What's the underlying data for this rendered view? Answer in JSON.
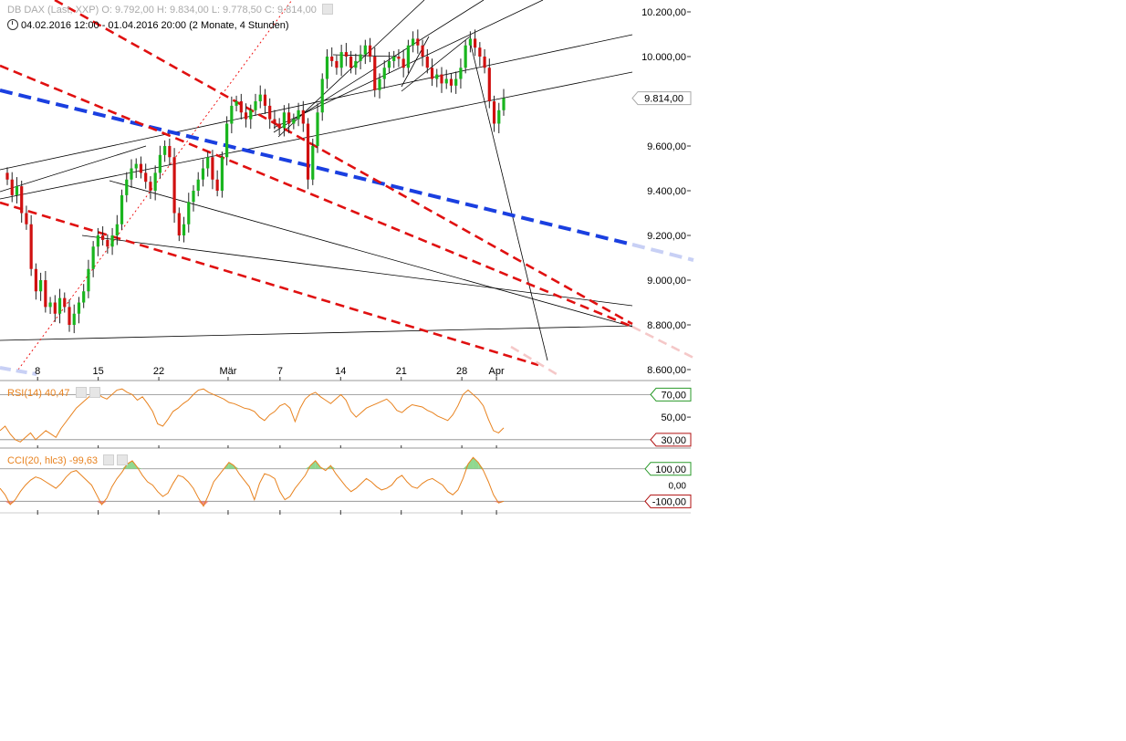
{
  "header": {
    "instrument": "DB DAX (Last, XXP)",
    "open": "O: 9.792,00",
    "high": "H: 9.834,00",
    "low": "L: 9.778,50",
    "close": "C: 9.814,00",
    "range": "04.02.2016 12:00 - 01.04.2016 20:00 (2 Monate, 4 Stunden)"
  },
  "chart_data": [
    {
      "type": "candlestick",
      "title": "DB DAX",
      "interval_hours": 4,
      "y_ticks": [
        "10.200,00",
        "10.000,00",
        "9.600,00",
        "9.400,00",
        "9.200,00",
        "9.000,00",
        "8.800,00",
        "8.600,00"
      ],
      "y_tick_values": [
        10200,
        10000,
        9600,
        9400,
        9200,
        9000,
        8800,
        8600
      ],
      "ylim": [
        8550,
        10400
      ],
      "x_ticks": [
        "8",
        "15",
        "22",
        "Mär",
        "7",
        "14",
        "21",
        "28",
        "Apr"
      ],
      "x_tick_dates": [
        "2016-02-08",
        "2016-02-15",
        "2016-02-22",
        "2016-03-01",
        "2016-03-07",
        "2016-03-14",
        "2016-03-21",
        "2016-03-28",
        "2016-04-01"
      ],
      "last_price_label": "9.814,00",
      "last_price": 9814,
      "closes": [
        9450,
        9380,
        9420,
        9300,
        9250,
        9050,
        8950,
        9000,
        8880,
        8900,
        8850,
        8920,
        8880,
        8800,
        8850,
        8900,
        8950,
        9050,
        9150,
        9200,
        9180,
        9150,
        9200,
        9250,
        9380,
        9450,
        9500,
        9520,
        9480,
        9440,
        9400,
        9480,
        9560,
        9600,
        9550,
        9300,
        9200,
        9250,
        9350,
        9400,
        9450,
        9500,
        9550,
        9450,
        9400,
        9550,
        9700,
        9780,
        9800,
        9750,
        9720,
        9760,
        9800,
        9830,
        9780,
        9720,
        9700,
        9680,
        9750,
        9700,
        9720,
        9760,
        9700,
        9450,
        9600,
        9750,
        9900,
        10000,
        9980,
        9950,
        10020,
        10000,
        9950,
        9980,
        10010,
        10050,
        10000,
        9850,
        9900,
        9950,
        9980,
        10000,
        9990,
        9950,
        10050,
        10080,
        10050,
        10000,
        9950,
        9900,
        9920,
        9880,
        9900,
        9870,
        9900,
        9950,
        10050,
        10080,
        10040,
        10000,
        9950,
        9800,
        9700,
        9760,
        9814
      ],
      "lines": {
        "trend_support_black": [
          [
            9640,
            9700
          ],
          [
            9900,
            9955
          ]
        ],
        "blue_dashed": [
          [
            9810,
            9210
          ]
        ],
        "red_dashed": [
          [
            10260,
            8780
          ],
          [
            10150,
            8560
          ],
          [
            9600,
            8450
          ]
        ]
      }
    },
    {
      "type": "line",
      "title": "RSI(14)",
      "value_label": "40,47",
      "levels": [
        "70,00",
        "50,00",
        "30,00"
      ],
      "level_values": [
        70,
        50,
        30
      ],
      "ylim": [
        25,
        80
      ],
      "values": [
        38,
        42,
        35,
        30,
        28,
        32,
        36,
        30,
        34,
        38,
        35,
        32,
        40,
        46,
        52,
        58,
        62,
        66,
        70,
        72,
        68,
        66,
        70,
        74,
        75,
        72,
        70,
        65,
        68,
        62,
        55,
        44,
        42,
        48,
        55,
        58,
        62,
        65,
        70,
        74,
        75,
        72,
        70,
        68,
        66,
        63,
        62,
        60,
        58,
        57,
        55,
        50,
        47,
        52,
        55,
        60,
        62,
        58,
        46,
        58,
        66,
        70,
        72,
        68,
        65,
        62,
        66,
        70,
        65,
        55,
        50,
        54,
        58,
        60,
        62,
        64,
        66,
        62,
        56,
        54,
        58,
        61,
        60,
        59,
        56,
        54,
        51,
        49,
        47,
        52,
        60,
        70,
        74,
        70,
        66,
        60,
        48,
        38,
        36,
        40.47
      ]
    },
    {
      "type": "area",
      "title": "CCI(20, hlc3)",
      "value_label": "-99,63",
      "levels": [
        "100,00",
        "0,00",
        "-100,00"
      ],
      "level_values": [
        100,
        0,
        -100
      ],
      "ylim": [
        -160,
        200
      ],
      "values": [
        -20,
        -60,
        -120,
        -90,
        -40,
        0,
        30,
        50,
        40,
        20,
        0,
        -20,
        10,
        50,
        80,
        90,
        60,
        30,
        0,
        -60,
        -120,
        -80,
        -10,
        40,
        80,
        130,
        150,
        110,
        60,
        20,
        0,
        -40,
        -70,
        -50,
        10,
        60,
        50,
        20,
        -20,
        -80,
        -130,
        -60,
        20,
        60,
        100,
        140,
        120,
        70,
        30,
        -10,
        -90,
        10,
        70,
        60,
        40,
        -40,
        -90,
        -70,
        -20,
        20,
        60,
        120,
        150,
        110,
        90,
        120,
        70,
        30,
        -10,
        -40,
        -20,
        10,
        40,
        20,
        -10,
        -30,
        -20,
        0,
        40,
        60,
        20,
        -10,
        -20,
        10,
        30,
        40,
        20,
        0,
        -40,
        -60,
        -30,
        40,
        130,
        170,
        140,
        90,
        20,
        -60,
        -110,
        -99.63
      ]
    }
  ]
}
